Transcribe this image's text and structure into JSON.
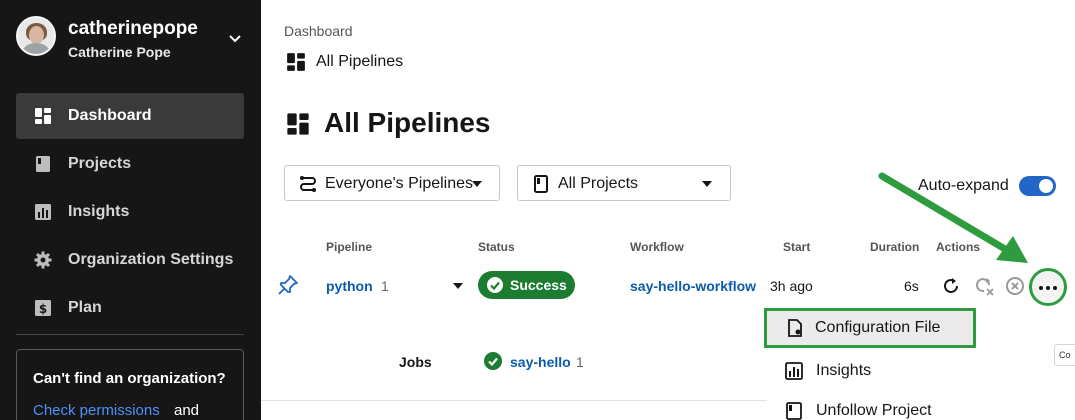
{
  "user": {
    "username": "catherinepope",
    "full_name": "Catherine Pope"
  },
  "sidebar": {
    "items": [
      {
        "label": "Dashboard",
        "icon": "dashboard-icon",
        "active": true
      },
      {
        "label": "Projects",
        "icon": "project-icon",
        "active": false
      },
      {
        "label": "Insights",
        "icon": "insights-icon",
        "active": false
      },
      {
        "label": "Organization Settings",
        "icon": "gear-icon",
        "active": false
      },
      {
        "label": "Plan",
        "icon": "dollar-icon",
        "active": false
      }
    ],
    "org_card": {
      "title": "Can't find an organization?",
      "link": "Check permissions",
      "suffix": "and"
    }
  },
  "breadcrumb": {
    "root": "Dashboard",
    "current": "All Pipelines"
  },
  "page_title": "All Pipelines",
  "filters": {
    "pipelines_select": "Everyone's Pipelines",
    "projects_select": "All Projects"
  },
  "auto_expand": {
    "label": "Auto-expand",
    "enabled": true
  },
  "table": {
    "headers": {
      "pipeline": "Pipeline",
      "status": "Status",
      "workflow": "Workflow",
      "start": "Start",
      "duration": "Duration",
      "actions": "Actions"
    },
    "row": {
      "pipeline": "python",
      "number": "1",
      "status": "Success",
      "workflow": "say-hello-workflow",
      "start": "3h ago",
      "duration": "6s"
    },
    "jobs": {
      "label": "Jobs",
      "job": "say-hello",
      "number": "1"
    }
  },
  "menu": {
    "items": [
      {
        "label": "Configuration File",
        "icon": "file-settings-icon"
      },
      {
        "label": "Insights",
        "icon": "insights-icon"
      },
      {
        "label": "Unfollow Project",
        "icon": "project-icon"
      }
    ],
    "cropped_tooltip": "Co"
  },
  "colors": {
    "sidebar_bg": "#161616",
    "success": "#1c7c32",
    "link": "#0b5cad",
    "toggle": "#2266c7",
    "annotation_green": "#2e9b3e"
  }
}
